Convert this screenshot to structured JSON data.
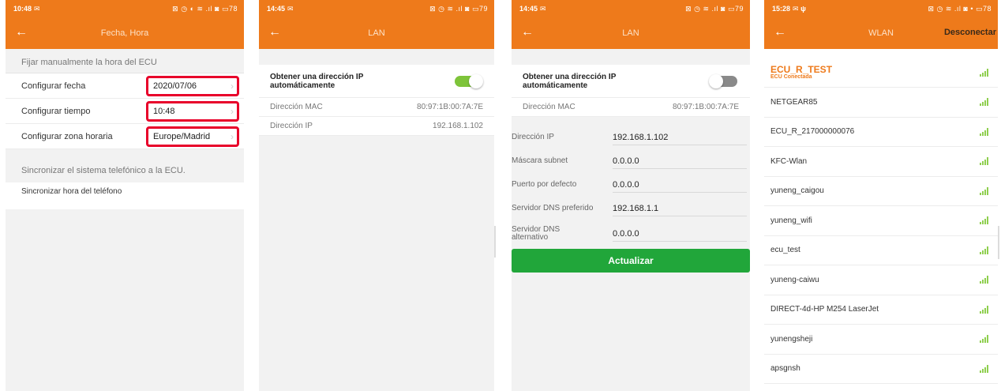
{
  "colors": {
    "accent": "#ee7a1b",
    "highlight": "#e8002a",
    "toggle_on": "#7ec43a",
    "button": "#21a63a"
  },
  "screen1": {
    "status": {
      "time": "10:48",
      "right": "⊠ ◷ ◐ ≋ .ıl ◙ ▭78"
    },
    "title": "Fecha, Hora",
    "section_manual": "Fijar manualmente la hora del ECU",
    "rows": [
      {
        "label": "Configurar fecha",
        "value": "2020/07/06"
      },
      {
        "label": "Configurar tiempo",
        "value": "10:48"
      },
      {
        "label": "Configurar zona horaria",
        "value": "Europe/Madrid"
      }
    ],
    "section_sync": "Sincronizar el sistema telefónico a la ECU.",
    "sync_label": "Sincronizar hora del teléfono"
  },
  "screen2": {
    "status": {
      "time": "14:45",
      "right": "⊠ ◷ ≋ .ıl ◙ ▭79"
    },
    "title": "LAN",
    "dhcp_label": "Obtener una dirección IP automáticamente",
    "dhcp_on": true,
    "mac_label": "Dirección MAC",
    "mac_value": "80:97:1B:00:7A:7E",
    "ip_label": "Dirección IP",
    "ip_value": "192.168.1.102"
  },
  "screen3": {
    "status": {
      "time": "14:45",
      "right": "⊠ ◷ ≋ .ıl ◙ ▭79"
    },
    "title": "LAN",
    "dhcp_label": "Obtener una dirección IP automáticamente",
    "dhcp_on": false,
    "mac_label": "Dirección MAC",
    "mac_value": "80:97:1B:00:7A:7E",
    "fields": [
      {
        "label": "Dirección IP",
        "value": "192.168.1.102"
      },
      {
        "label": "Máscara subnet",
        "value": "0.0.0.0"
      },
      {
        "label": "Puerto por defecto",
        "value": "0.0.0.0"
      },
      {
        "label": "Servidor DNS preferido",
        "value": "192.168.1.1"
      },
      {
        "label": "Servidor DNS alternativo",
        "value": "0.0.0.0"
      }
    ],
    "update_button": "Actualizar"
  },
  "screen4": {
    "status": {
      "time": "15:28",
      "right": "⊠ ◷ ≋ .ıl ◙ • ▭78"
    },
    "title": "WLAN",
    "disconnect": "Desconectar",
    "connected_ssid": "ECU_R_TEST",
    "connected_sub": "ECU Conectada",
    "networks": [
      "NETGEAR85",
      "ECU_R_217000000076",
      "KFC-Wlan",
      "yuneng_caigou",
      "yuneng_wifi",
      "ecu_test",
      "yuneng-caiwu",
      "DIRECT-4d-HP M254 LaserJet",
      "yunengsheji",
      "apsgnsh"
    ]
  }
}
